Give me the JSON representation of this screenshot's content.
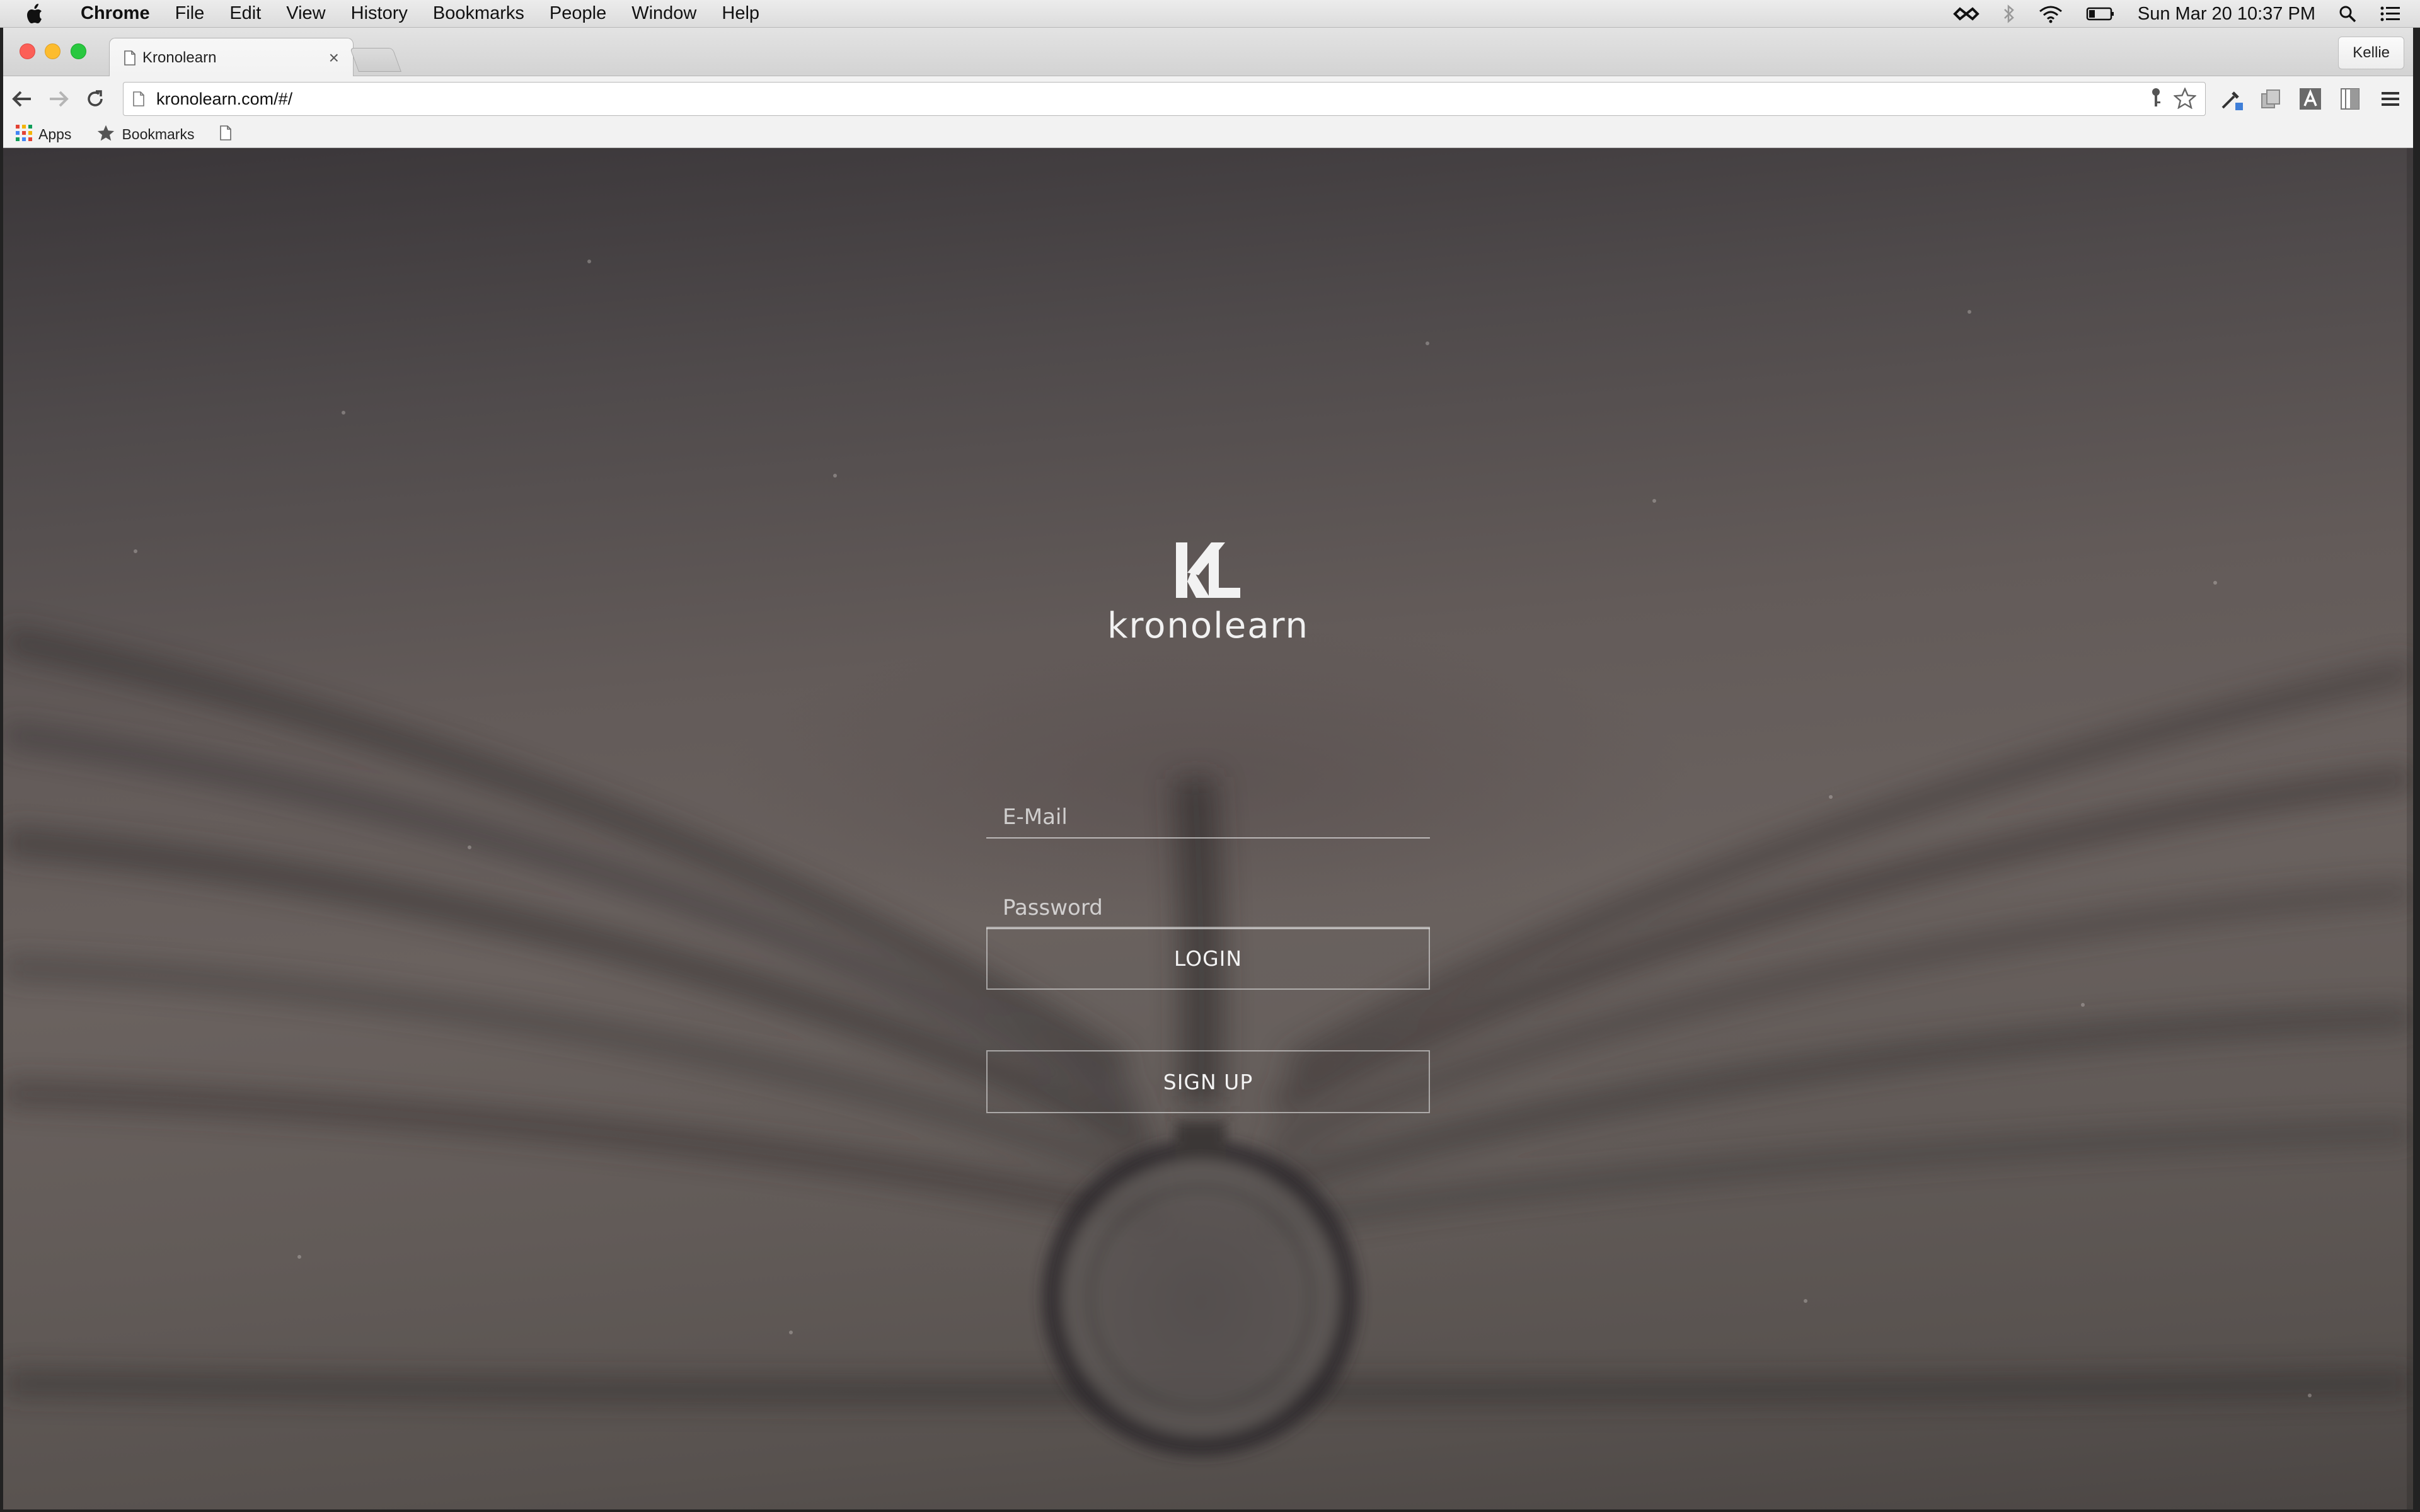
{
  "os_menubar": {
    "app_name": "Chrome",
    "menus": [
      "File",
      "Edit",
      "View",
      "History",
      "Bookmarks",
      "People",
      "Window",
      "Help"
    ],
    "clock": "Sun Mar 20  10:37 PM"
  },
  "browser": {
    "tab": {
      "title": "Kronolearn",
      "close": "×"
    },
    "profile_name": "Kellie",
    "url": "kronolearn.com/#/",
    "bookmarks_bar": {
      "apps_label": "Apps",
      "bookmarks_label": "Bookmarks"
    }
  },
  "login_page": {
    "logo_mark": "KL",
    "brand_name": "kronolearn",
    "email_placeholder": "E-Mail",
    "password_placeholder": "Password",
    "login_label": "LOGIN",
    "signup_label": "SIGN UP"
  },
  "colors": {
    "accent_red": "#fc5f57",
    "accent_yellow": "#fdbc2e",
    "accent_green": "#29c840",
    "page_text": "#f1f1f1"
  }
}
